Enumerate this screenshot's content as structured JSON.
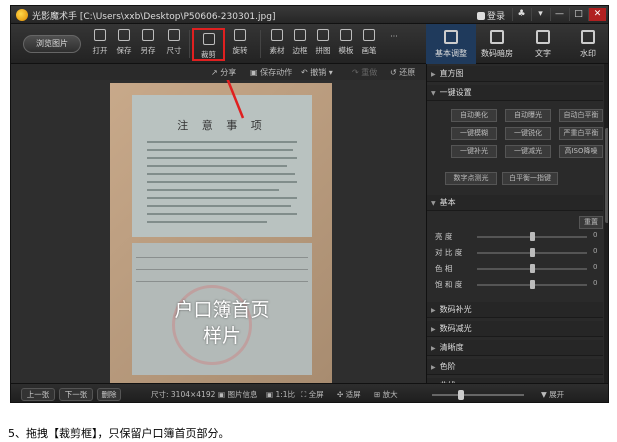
{
  "window": {
    "title": "光影魔术手 [C:\\Users\\xxb\\Desktop\\P50606-230301.jpg]",
    "login": "登录",
    "controls": [
      "♣",
      "▾",
      "—",
      "□",
      "✕"
    ]
  },
  "toolbar": {
    "browse": "浏览图片",
    "tools": [
      {
        "label": "打开",
        "icon": "open-icon"
      },
      {
        "label": "保存",
        "icon": "save-icon"
      },
      {
        "label": "另存",
        "icon": "save-as-icon"
      },
      {
        "label": "尺寸",
        "icon": "size-icon"
      },
      {
        "label": "裁剪",
        "icon": "crop-icon"
      },
      {
        "label": "旋转",
        "icon": "rotate-icon"
      },
      {
        "label": "素材",
        "icon": "material-icon"
      },
      {
        "label": "边框",
        "icon": "border-icon"
      },
      {
        "label": "拼图",
        "icon": "collage-icon"
      },
      {
        "label": "模板",
        "icon": "template-icon"
      },
      {
        "label": "画笔",
        "icon": "brush-icon"
      }
    ],
    "more": "···",
    "right_tabs": [
      {
        "label": "基本调整",
        "icon": "adjust-icon"
      },
      {
        "label": "数码暗房",
        "icon": "darkroom-icon"
      },
      {
        "label": "文字",
        "icon": "text-icon"
      },
      {
        "label": "水印",
        "icon": "watermark-icon"
      }
    ]
  },
  "subbar": {
    "share": "分享",
    "save_action": "保存动作",
    "undo": "撤销",
    "redo": "重做",
    "restore": "还原"
  },
  "photo": {
    "notice_title": "注 意 事 项",
    "overlay_line1": "户口簿首页",
    "overlay_line2": "样片"
  },
  "bottombar": {
    "prev": "上一张",
    "next": "下一张",
    "delete": "删除",
    "size": "尺寸: 3104×4192",
    "image_info": "图片信息",
    "ratio": "1:1比",
    "fullscreen": "全屏",
    "fit": "适屏",
    "enlarge": "放大",
    "expand": "展开",
    "zoom_level": 0.3
  },
  "panel": {
    "histogram": "直方图",
    "one_click": "一键设置",
    "one_click_buttons": [
      "自动美化",
      "自动曝光",
      "自动白平衡",
      "一键模糊",
      "一键锐化",
      "严重白平衡",
      "一键补光",
      "一键减光",
      "高ISO降噪",
      "数字点测光",
      "白平衡一指键"
    ],
    "basic": "基本",
    "reset": "重置",
    "sliders": [
      {
        "label": "亮    度",
        "value": "0",
        "level": 0.5
      },
      {
        "label": "对 比 度",
        "value": "0",
        "level": 0.5
      },
      {
        "label": "色    相",
        "value": "0",
        "level": 0.5
      },
      {
        "label": "饱 和 度",
        "value": "0",
        "level": 0.5
      }
    ],
    "sections": [
      "数码补光",
      "数码减光",
      "清晰度",
      "色阶",
      "曲线"
    ]
  },
  "caption": "5、拖拽【裁剪框】，只保留户口簿首页部分。"
}
